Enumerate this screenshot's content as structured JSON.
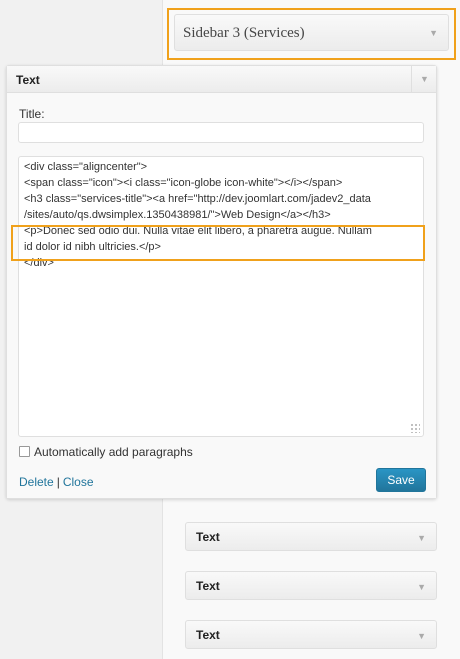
{
  "sidebar": {
    "title": "Sidebar 3 (Services)",
    "toggle_icon": "▼",
    "highlight_color": "#f0a11b"
  },
  "widget": {
    "title": "Text",
    "toggle_icon": "▼",
    "title_label": "Title:",
    "title_value": "",
    "content_lines": [
      "<div class=\"aligncenter\">",
      "<span class=\"icon\"><i class=\"icon-globe icon-white\"></i></span>",
      "<h3 class=\"services-title\"><a href=\"http://dev.joomlart.com/jadev2_data",
      "/sites/auto/qs.dwsimplex.1350438981/\">Web Design</a></h3>",
      "<p>Donec sed odio dui. Nulla vitae elit libero, a pharetra augue. Nullam",
      "id dolor id nibh ultricies.</p>",
      "</div>"
    ],
    "auto_paragraphs_label": "Automatically add paragraphs",
    "auto_paragraphs_checked": false,
    "delete_label": "Delete",
    "separator": "|",
    "close_label": "Close",
    "save_label": "Save",
    "save_color": "#21759b"
  },
  "collapsed_widgets": [
    {
      "title": "Text",
      "toggle_icon": "▼"
    },
    {
      "title": "Text",
      "toggle_icon": "▼"
    },
    {
      "title": "Text",
      "toggle_icon": "▼"
    }
  ]
}
